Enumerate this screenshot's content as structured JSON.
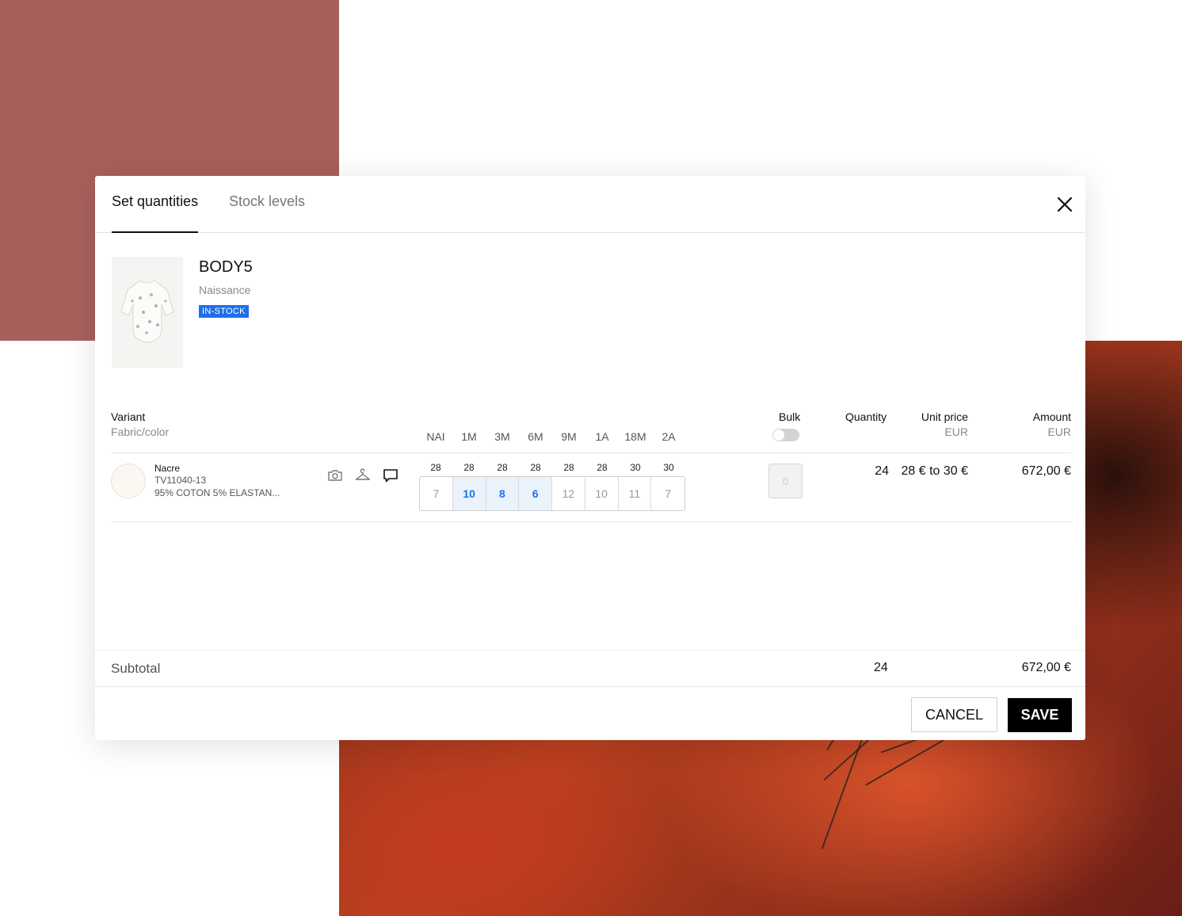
{
  "tabs": [
    {
      "label": "Set quantities",
      "active": true
    },
    {
      "label": "Stock levels",
      "active": false
    }
  ],
  "product": {
    "name": "BODY5",
    "collection": "Naissance",
    "badge": "IN-STOCK",
    "badge_color": "#1f6fe8"
  },
  "columns": {
    "variant": "Variant",
    "variant_sub": "Fabric/color",
    "sizes": [
      "NAI",
      "1M",
      "3M",
      "6M",
      "9M",
      "1A",
      "18M",
      "2A"
    ],
    "bulk": "Bulk",
    "quantity": "Quantity",
    "unit_price": "Unit price",
    "unit_price_currency": "EUR",
    "amount": "Amount",
    "amount_currency": "EUR"
  },
  "variant_row": {
    "color_name": "Nacre",
    "code": "TV11040-13",
    "fabric": "95% COTON 5% ELASTAN...",
    "swatch_color": "#fbf8f1",
    "stock": [
      "28",
      "28",
      "28",
      "28",
      "28",
      "28",
      "30",
      "30"
    ],
    "quantities": [
      "7",
      "10",
      "8",
      "6",
      "12",
      "10",
      "11",
      "7"
    ],
    "bulk_value": "0",
    "quantity": "24",
    "unit_price": "28 € to 30 €",
    "amount": "672,00 €",
    "icons": [
      "camera-icon",
      "hanger-icon",
      "comment-icon"
    ]
  },
  "subtotal": {
    "label": "Subtotal",
    "quantity": "24",
    "amount": "672,00 €"
  },
  "actions": {
    "cancel": "CANCEL",
    "save": "SAVE"
  }
}
